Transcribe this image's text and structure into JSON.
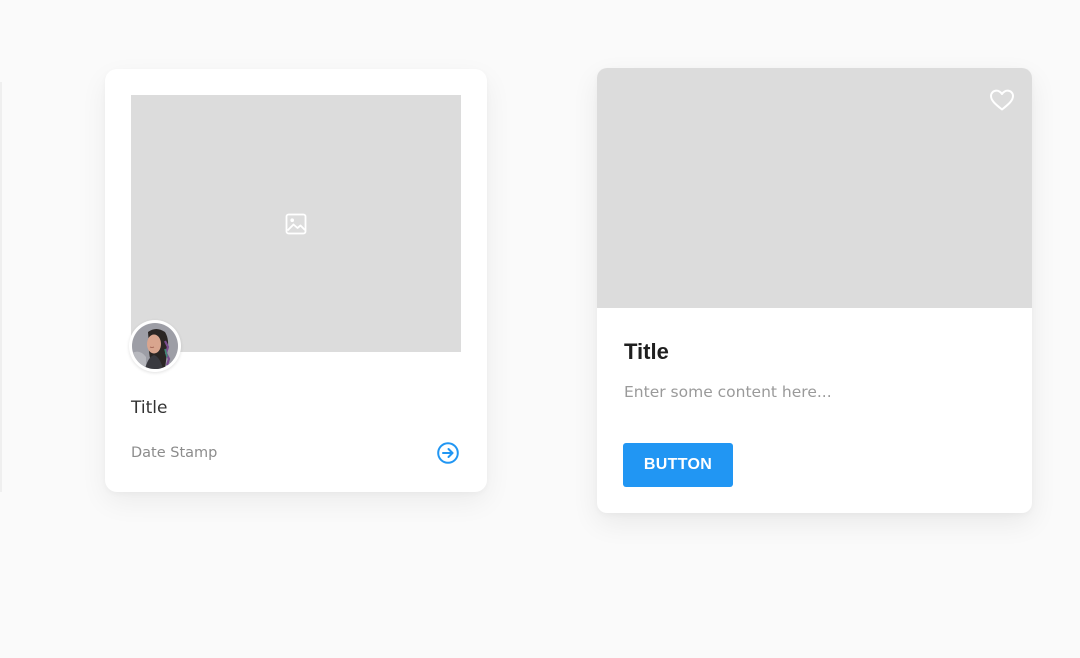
{
  "card_left": {
    "title": "Title",
    "date_stamp": "Date Stamp",
    "image_placeholder_icon": "image-icon",
    "avatar_icon": "avatar",
    "action_icon": "arrow-right-circle-icon"
  },
  "card_right": {
    "title": "Title",
    "content": "Enter some content here...",
    "button_label": "BUTTON",
    "favorite_icon": "heart-icon"
  },
  "colors": {
    "background": "#fafafa",
    "card": "#ffffff",
    "placeholder": "#dcdcdc",
    "accent": "#2196f3"
  }
}
